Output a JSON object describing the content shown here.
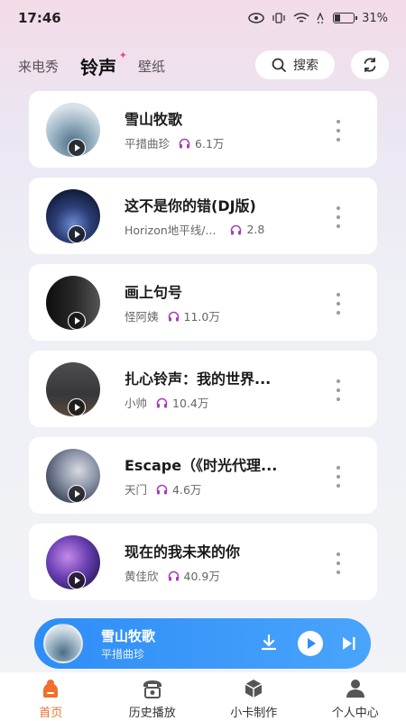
{
  "status": {
    "time": "17:46",
    "battery": "31%",
    "battery_level": 0.31
  },
  "header": {
    "tabs": [
      {
        "label": "来电秀",
        "active": false
      },
      {
        "label": "铃声",
        "active": true
      },
      {
        "label": "壁纸",
        "active": false
      }
    ],
    "search_label": "搜索"
  },
  "songs": [
    {
      "title": "雪山牧歌",
      "artist": "平措曲珍",
      "plays": "6.1万"
    },
    {
      "title": "这不是你的错(DJ版)",
      "artist": "Horizon地平线/...",
      "plays": "2.8"
    },
    {
      "title": "画上句号",
      "artist": "怪阿姨",
      "plays": "11.0万"
    },
    {
      "title": "扎心铃声：我的世界...",
      "artist": "小帅",
      "plays": "10.4万"
    },
    {
      "title": "Escape（《时光代理...",
      "artist": "天门",
      "plays": "4.6万"
    },
    {
      "title": "现在的我未来的你",
      "artist": "黄佳欣",
      "plays": "40.9万"
    }
  ],
  "player": {
    "title": "雪山牧歌",
    "artist": "平措曲珍"
  },
  "nav": [
    {
      "label": "首页",
      "active": true
    },
    {
      "label": "历史播放",
      "active": false
    },
    {
      "label": "小卡制作",
      "active": false
    },
    {
      "label": "个人中心",
      "active": false
    }
  ],
  "colors": {
    "accent_pink": "#e94b8e",
    "player_blue": "#2e8df7",
    "nav_active": "#f0702c"
  },
  "icons": [
    "wifi-icon",
    "battery-icon",
    "search-icon",
    "refresh-icon",
    "headphone-icon",
    "more-icon",
    "play-icon",
    "download-icon",
    "next-icon",
    "home-icon",
    "phone-icon",
    "box-icon",
    "user-icon"
  ]
}
